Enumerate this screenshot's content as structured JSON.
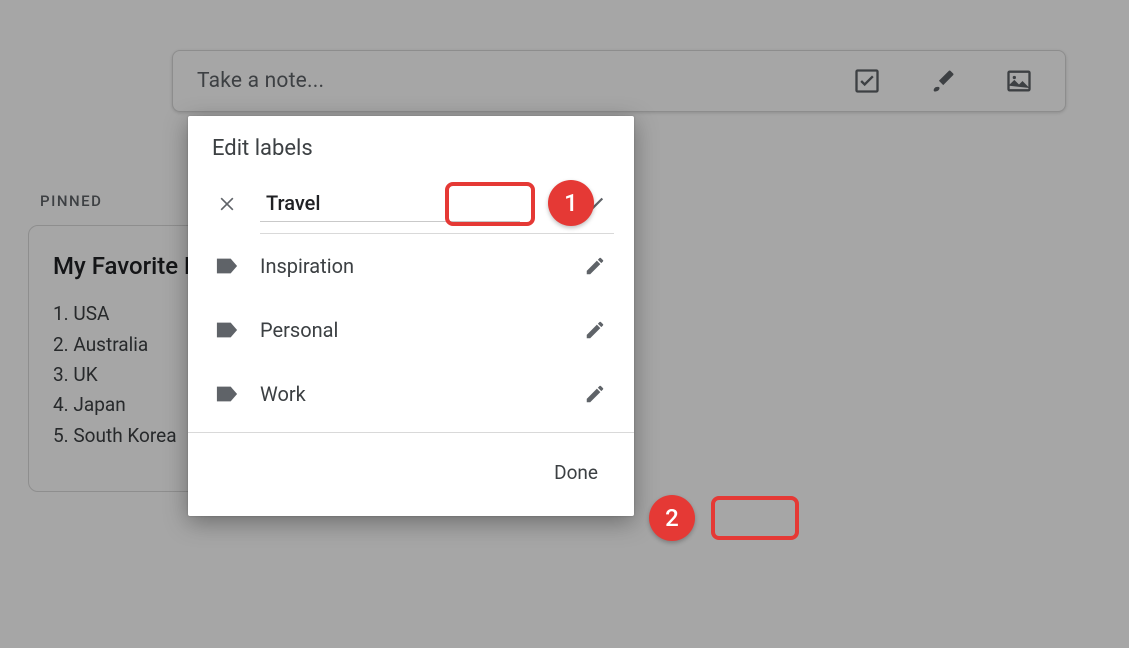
{
  "note_bar": {
    "placeholder": "Take a note..."
  },
  "pinned_label": "PINNED",
  "note_card": {
    "title": "My Favorite Destinations",
    "items": [
      "1. USA",
      "2. Australia",
      "3. UK",
      "4. Japan",
      "5. South Korea"
    ]
  },
  "modal": {
    "title": "Edit labels",
    "editing_value": "Travel",
    "labels": [
      "Inspiration",
      "Personal",
      "Work"
    ],
    "done_label": "Done"
  },
  "callouts": {
    "c1": "1",
    "c2": "2"
  }
}
